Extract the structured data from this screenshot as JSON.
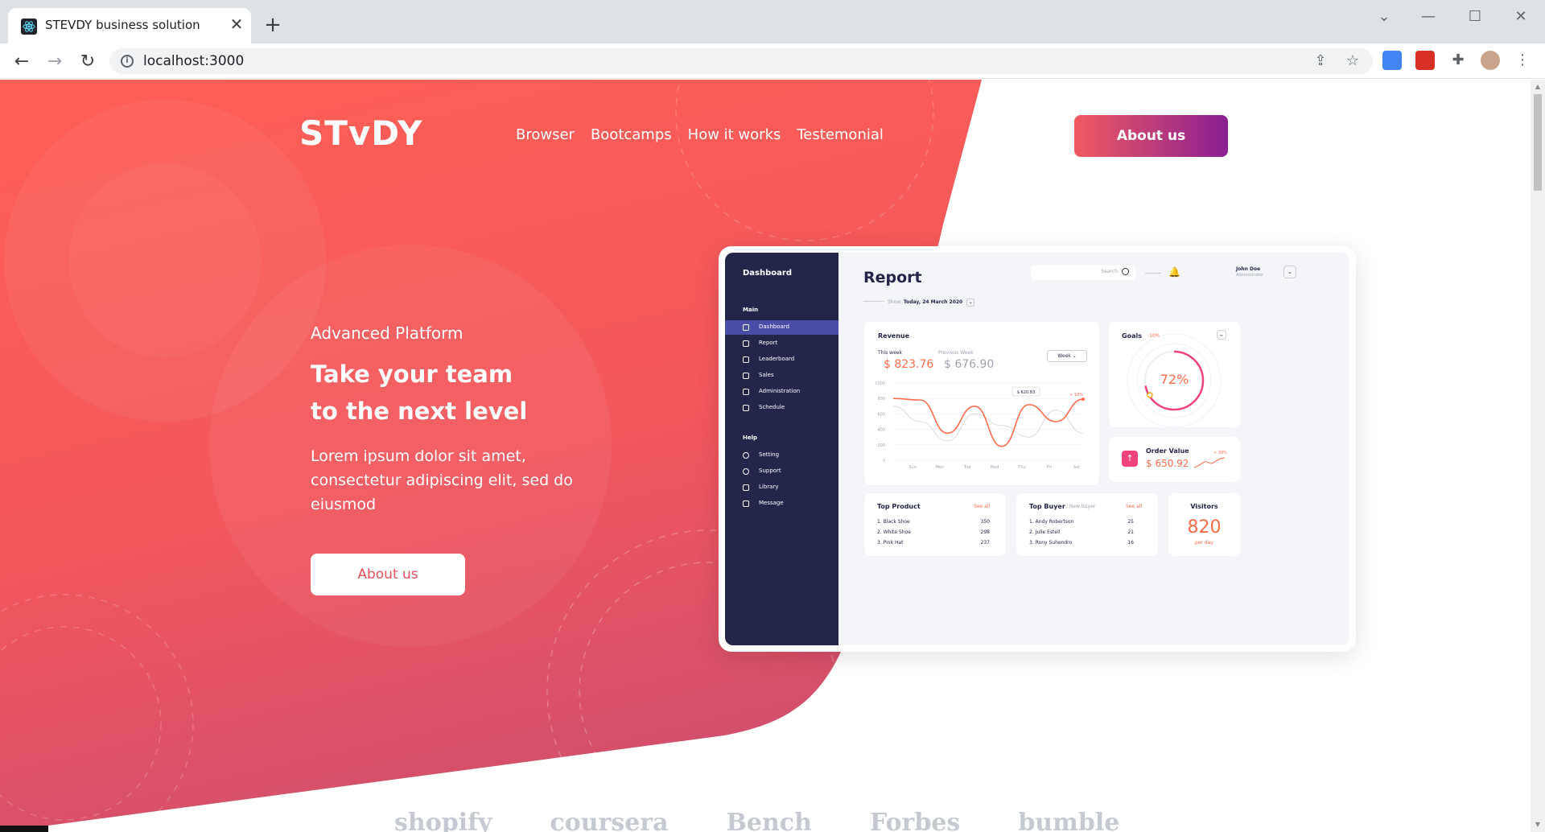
{
  "browser": {
    "tab_title": "STEVDY business solution",
    "tab_close": "✕",
    "new_tab": "+",
    "url": "localhost:3000",
    "nav_back": "←",
    "nav_forward": "→",
    "nav_reload": "↻",
    "win_chevron": "⌄",
    "win_minimize": "—",
    "win_maximize": "☐",
    "win_close": "✕"
  },
  "header": {
    "logo": "STvDY",
    "nav": [
      "Browser",
      "Bootcamps",
      "How it works",
      "Testemonial"
    ],
    "cta": "About us"
  },
  "hero": {
    "kicker": "Advanced Platform",
    "title_line1": "Take your team",
    "title_line2": "to the next level",
    "text": "Lorem ipsum dolor sit amet, consectetur adipiscing elit, sed do eiusmod",
    "cta": "About us"
  },
  "dashboard": {
    "sidebar_title": "Dashboard",
    "section_main": "Main",
    "main_items": [
      "Dashboard",
      "Report",
      "Leaderboard",
      "Sales",
      "Administration",
      "Schedule"
    ],
    "section_help": "Help",
    "help_items": [
      "Setting",
      "Support",
      "Library",
      "Message"
    ],
    "page_title": "Report",
    "search_placeholder": "Search",
    "user_name": "John Doe",
    "user_role": "Administrator",
    "show_label": "Show:",
    "show_value": "Today, 24 March 2020",
    "revenue": {
      "title": "Revenue",
      "this_week_label": "This week",
      "this_week_value": "$ 823.76",
      "prev_week_label": "Previous Week",
      "prev_week_value": "$ 676.90",
      "period": "Week",
      "tooltip": "$ 620.83",
      "badge": "+ 10%"
    },
    "goals": {
      "title": "Goals",
      "delta": "-10%",
      "value": "72%",
      "progress": 0.72
    },
    "order": {
      "title": "Order Value",
      "value": "$ 650.92",
      "delta": "+ 20%"
    },
    "top_product": {
      "title": "Top Product",
      "see_all": "See all",
      "rows": [
        {
          "name": "1. Black Shoe",
          "count": "350"
        },
        {
          "name": "2. White Shoe",
          "count": "298"
        },
        {
          "name": "3. Pink Hat",
          "count": "237"
        }
      ]
    },
    "top_buyer": {
      "title": "Top Buyer",
      "subtitle": "/ New buyer",
      "see_all": "See all",
      "rows": [
        {
          "name": "1. Andy Robertson",
          "count": "25"
        },
        {
          "name": "2. Julie Estell",
          "count": "21"
        },
        {
          "name": "3. Rony Suhendro",
          "count": "16"
        }
      ]
    },
    "visitors": {
      "title": "Visitors",
      "value": "820",
      "unit": "per day"
    }
  },
  "chart_data": {
    "type": "line",
    "title": "Revenue",
    "categories": [
      "Sun",
      "Mon",
      "Tue",
      "Wed",
      "Thu",
      "Fri",
      "Sat"
    ],
    "y_ticks": [
      "1000",
      "800",
      "600",
      "400",
      "200",
      "0"
    ],
    "ylim": [
      0,
      1000
    ],
    "series": [
      {
        "name": "This week",
        "color": "#ff6b4a",
        "values": [
          800,
          780,
          350,
          700,
          180,
          720,
          500,
          790
        ]
      },
      {
        "name": "Previous Week",
        "color": "#d0d2da",
        "values": [
          700,
          500,
          250,
          600,
          450,
          300,
          650,
          350
        ]
      }
    ]
  },
  "brands": [
    "shopify",
    "coursera",
    "Bench",
    "Forbes",
    "bumble"
  ],
  "colors": {
    "hero": "#fe5f55",
    "accent": "#ff6b4a",
    "sidebar": "#23264a"
  }
}
